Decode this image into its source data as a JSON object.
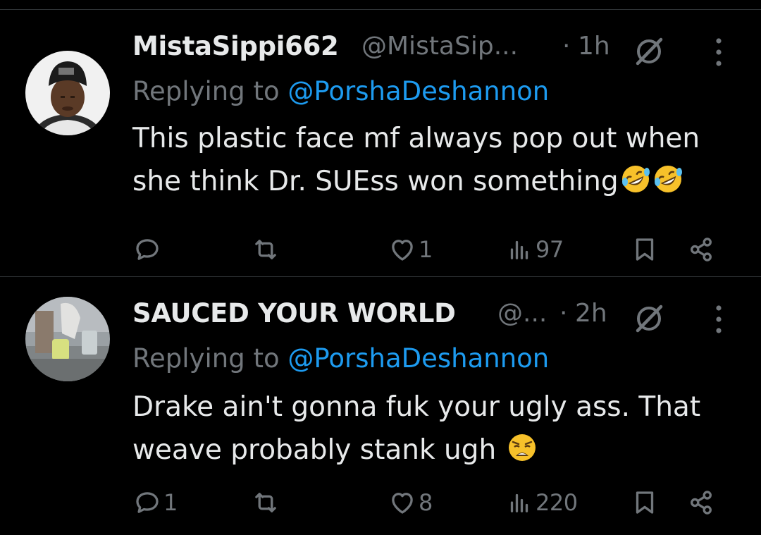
{
  "tweets": [
    {
      "display_name": "MistaSippi662",
      "handle": "@MistaSip...",
      "dot": "·",
      "time": "1h",
      "reply_prefix": "Replying to",
      "reply_mention": "@PorshaDeshannon",
      "text_line1": "This plastic face mf always pop out when",
      "text_line2": "she think Dr. SUEss won something",
      "emojis": [
        "rolling-on-floor-laughing",
        "rolling-on-floor-laughing"
      ],
      "replies": "",
      "reposts": "",
      "likes": "1",
      "views": "97"
    },
    {
      "display_name": "SAUCED YOUR WORLD",
      "handle": "@...",
      "dot": "·",
      "time": "2h",
      "reply_prefix": "Replying to",
      "reply_mention": "@PorshaDeshannon",
      "text_line1": "Drake ain't gonna fuk your ugly ass. That",
      "text_line2": "weave probably stank ugh",
      "emojis": [
        "weary-face"
      ],
      "replies": "1",
      "reposts": "",
      "likes": "8",
      "views": "220"
    }
  ],
  "colors": {
    "background": "#000000",
    "text": "#e7e9ea",
    "muted": "#71767b",
    "link": "#1d9bf0",
    "divider": "#2f3336"
  }
}
